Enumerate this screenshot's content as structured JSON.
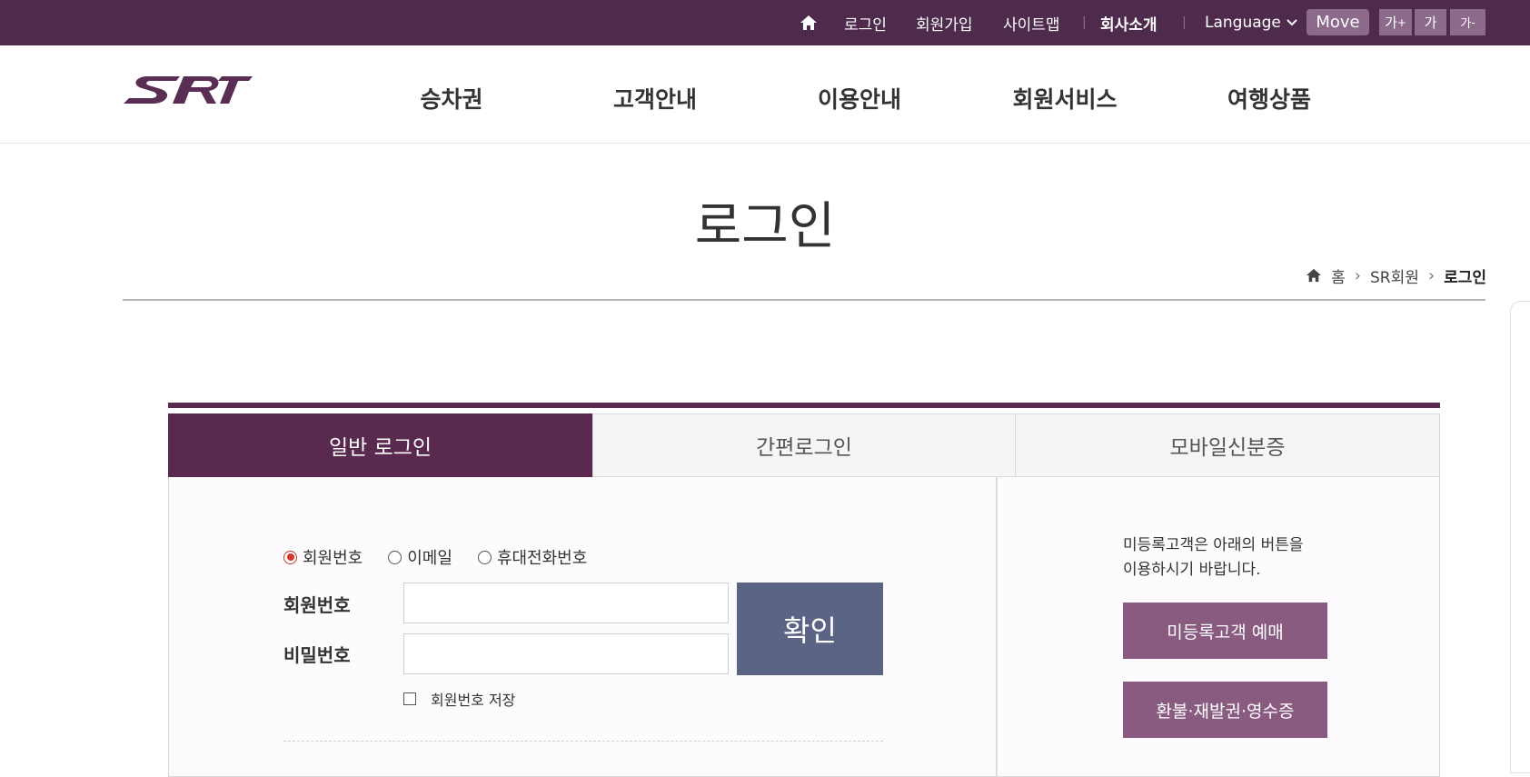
{
  "topbar": {
    "login": "로그인",
    "signup": "회원가입",
    "sitemap": "사이트맵",
    "company": "회사소개",
    "language": "Language",
    "move": "Move",
    "font_increase": "가",
    "font_increase_mark": "+",
    "font_default": "가",
    "font_decrease": "가",
    "font_decrease_mark": "-"
  },
  "nav": {
    "items": [
      "승차권",
      "고객안내",
      "이용안내",
      "회원서비스",
      "여행상품"
    ]
  },
  "logo": {
    "alt": "SRT"
  },
  "page": {
    "title": "로그인",
    "breadcrumb": [
      "홈",
      "SR회원",
      "로그인"
    ]
  },
  "login": {
    "tabs": [
      "일반 로그인",
      "간편로그인",
      "모바일신분증"
    ],
    "radio_options": [
      "회원번호",
      "이메일",
      "휴대전화번호"
    ],
    "selected_radio": "회원번호",
    "member_number_label": "회원번호",
    "password_label": "비밀번호",
    "member_number_value": "",
    "password_value": "",
    "confirm_label": "확인",
    "save_label": "회원번호 저장"
  },
  "guest": {
    "guide_line1": "미등록고객은 아래의 버튼을",
    "guide_line2": "이용하시기 바랍니다.",
    "reserve_button": "미등록고객 예매",
    "refund_button": "환불·재발권·영수증"
  },
  "colors": {
    "brand_purple": "#4e2a4d",
    "tab_active": "#59294f",
    "confirm_button": "#5b6484",
    "side_button": "#8a5b81",
    "radio_checked": "#d8342e"
  }
}
